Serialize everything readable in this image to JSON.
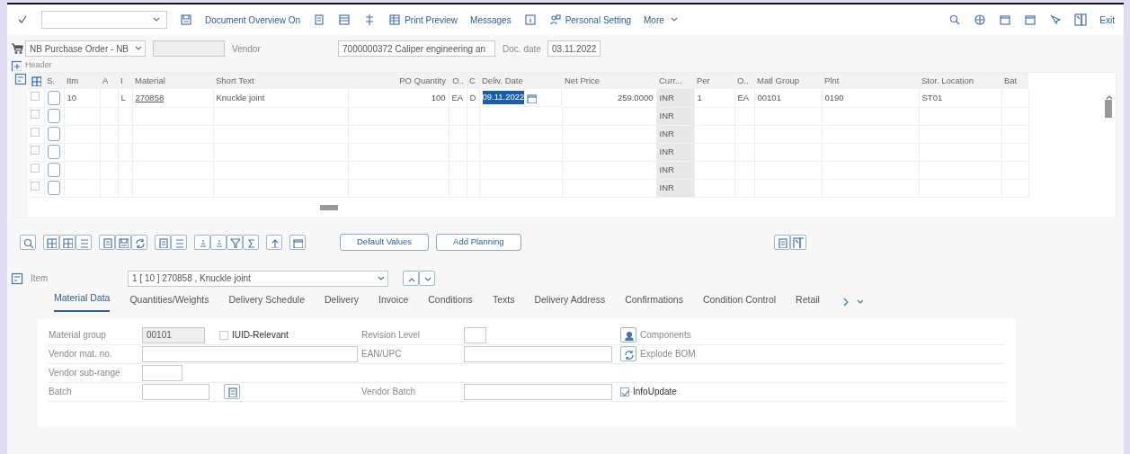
{
  "toolbar": {
    "buttons": [
      "Document Overview On",
      "Print Preview",
      "Messages",
      "Personal Setting",
      "More"
    ],
    "exit": "Exit"
  },
  "header": {
    "order_type": "NB Purchase Order - NB",
    "vendor_label": "Vendor",
    "vendor": "7000000372 Caliper engineering an",
    "doc_date_label": "Doc. date",
    "doc_date": "03.11.2022",
    "section": "Header"
  },
  "table": {
    "columns": [
      "S.",
      "Itm",
      "A",
      "I",
      "Material",
      "Short Text",
      "PO Quantity",
      "O..",
      "C",
      "Deliv. Date",
      "Net Price",
      "Curr...",
      "Per",
      "O..",
      "Matl Group",
      "Plnt",
      "Stor. Location",
      "Bat"
    ],
    "rows": [
      {
        "selected": false,
        "cells": [
          null,
          "10",
          null,
          "L",
          "270858",
          "Knuckle joint",
          "100",
          "EA",
          "D",
          {
            "text": "09.11.2022",
            "selected": true
          },
          "259.0000",
          "INR",
          "1",
          "EA",
          "00101",
          "0190",
          "ST01",
          null
        ]
      },
      {
        "selected": false,
        "cells": [
          null,
          null,
          null,
          null,
          null,
          null,
          null,
          null,
          null,
          null,
          null,
          "INR",
          null,
          null,
          null,
          null,
          null,
          null
        ]
      },
      {
        "selected": false,
        "cells": [
          null,
          null,
          null,
          null,
          null,
          null,
          null,
          null,
          null,
          null,
          null,
          "INR",
          null,
          null,
          null,
          null,
          null,
          null
        ]
      },
      {
        "selected": false,
        "cells": [
          null,
          null,
          null,
          null,
          null,
          null,
          null,
          null,
          null,
          null,
          null,
          "INR",
          null,
          null,
          null,
          null,
          null,
          null
        ]
      },
      {
        "selected": false,
        "cells": [
          null,
          null,
          null,
          null,
          null,
          null,
          null,
          null,
          null,
          null,
          null,
          "INR",
          null,
          null,
          null,
          null,
          null,
          null
        ]
      },
      {
        "selected": false,
        "cells": [
          null,
          null,
          null,
          null,
          null,
          null,
          null,
          null,
          null,
          null,
          null,
          "INR",
          null,
          null,
          null,
          null,
          null,
          null
        ]
      }
    ]
  },
  "table_buttons": [
    "Default Values",
    "Add Planning"
  ],
  "item": {
    "label": "Item",
    "value": "1 [ 10 ] 270858 , Knuckle joint"
  },
  "tabs": [
    {
      "label": "Material Data",
      "selected": true
    },
    {
      "label": "Quantities/Weights",
      "selected": false
    },
    {
      "label": "Delivery Schedule",
      "selected": false
    },
    {
      "label": "Delivery",
      "selected": false
    },
    {
      "label": "Invoice",
      "selected": false
    },
    {
      "label": "Conditions",
      "selected": false
    },
    {
      "label": "Texts",
      "selected": false
    },
    {
      "label": "Delivery Address",
      "selected": false
    },
    {
      "label": "Confirmations",
      "selected": false
    },
    {
      "label": "Condition Control",
      "selected": false
    },
    {
      "label": "Retail",
      "selected": false
    }
  ],
  "form": {
    "rows": [
      {
        "label": "Material group",
        "field": {
          "value": "00101",
          "readonly": true
        },
        "checkbox": {
          "text": "IUID-Relevant",
          "checked": false
        },
        "label2": "Revision Level",
        "field2": {},
        "action": "Components"
      },
      {
        "label": "Vendor mat. no.",
        "field": {},
        "label2": "EAN/UPC",
        "field2": {},
        "action": "Explode BOM"
      },
      {
        "label": "Vendor sub-range",
        "field": {}
      },
      {
        "label": "Batch",
        "field": {},
        "lookup": true,
        "label2": "Vendor Batch",
        "field2": {},
        "checkbox2": {
          "text": "InfoUpdate",
          "checked": true
        }
      }
    ]
  }
}
